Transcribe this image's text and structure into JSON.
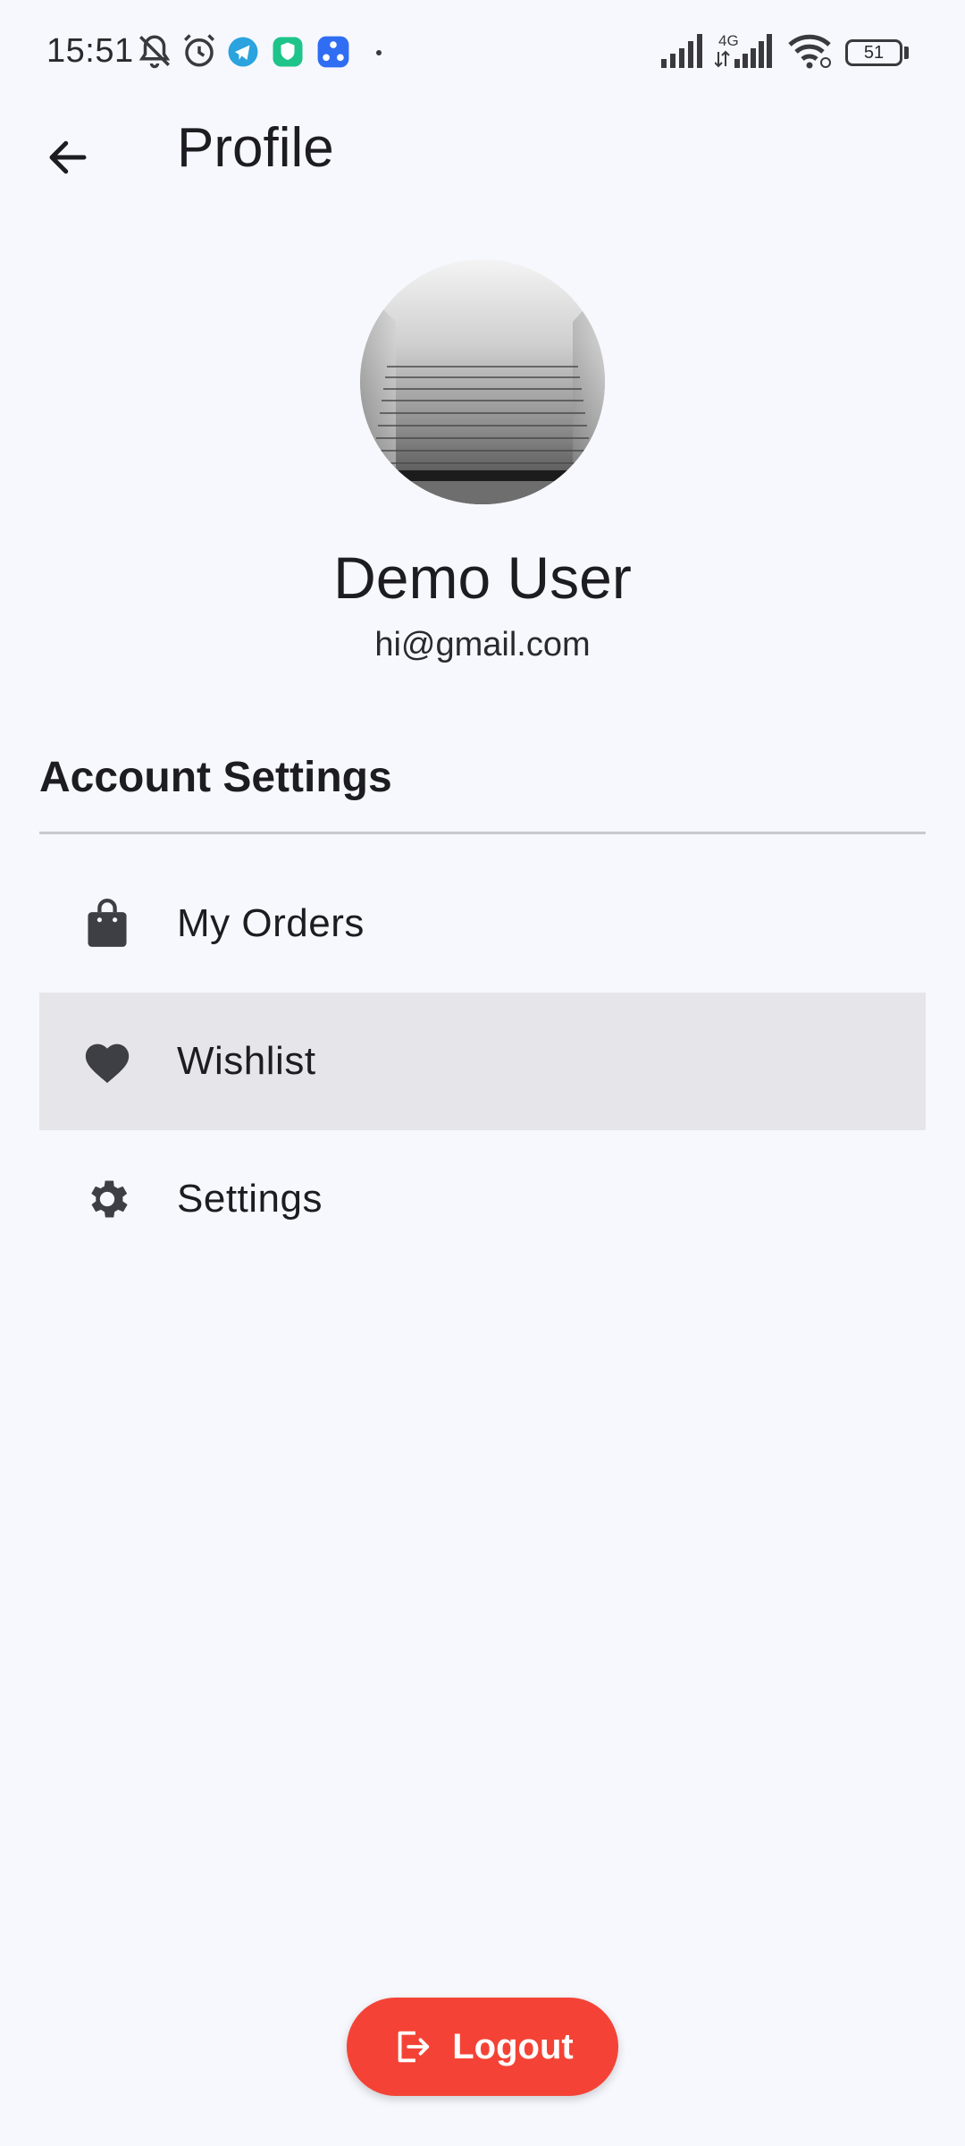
{
  "status_bar": {
    "time": "15:51",
    "network_label": "4G",
    "battery": "51"
  },
  "app_bar": {
    "title": "Profile"
  },
  "profile": {
    "name": "Demo User",
    "email": "hi@gmail.com"
  },
  "section": {
    "title": "Account Settings"
  },
  "menu": {
    "items": [
      {
        "label": "My Orders",
        "icon": "shopping-bag-icon"
      },
      {
        "label": "Wishlist",
        "icon": "heart-icon"
      },
      {
        "label": "Settings",
        "icon": "gear-icon"
      }
    ]
  },
  "logout": {
    "label": "Logout"
  },
  "colors": {
    "background": "#f7f8fd",
    "accent": "#f44336",
    "selected_row": "#e5e5ea",
    "icon": "#3d3f44"
  }
}
